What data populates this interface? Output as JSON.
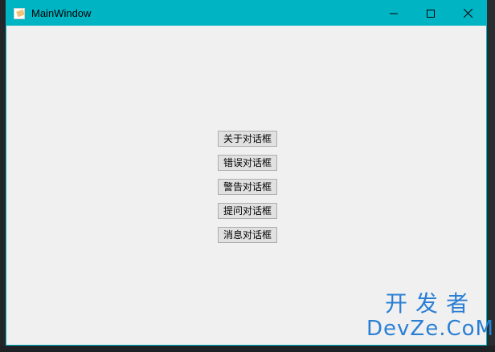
{
  "window": {
    "title": "MainWindow"
  },
  "buttons": [
    {
      "label": "关于对话框"
    },
    {
      "label": "错误对话框"
    },
    {
      "label": "警告对话框"
    },
    {
      "label": "提问对话框"
    },
    {
      "label": "消息对话框"
    }
  ],
  "watermark": {
    "top": "开发者",
    "bottom": "DevZe.CoM"
  },
  "colors": {
    "titlebar": "#00b4c4",
    "client_bg": "#f0f0f0",
    "button_bg": "#e1e1e1",
    "button_border": "#adadad",
    "watermark": "#2a7fd4"
  },
  "icons": {
    "app": "app-icon",
    "minimize": "minimize-icon",
    "maximize": "maximize-icon",
    "close": "close-icon"
  }
}
